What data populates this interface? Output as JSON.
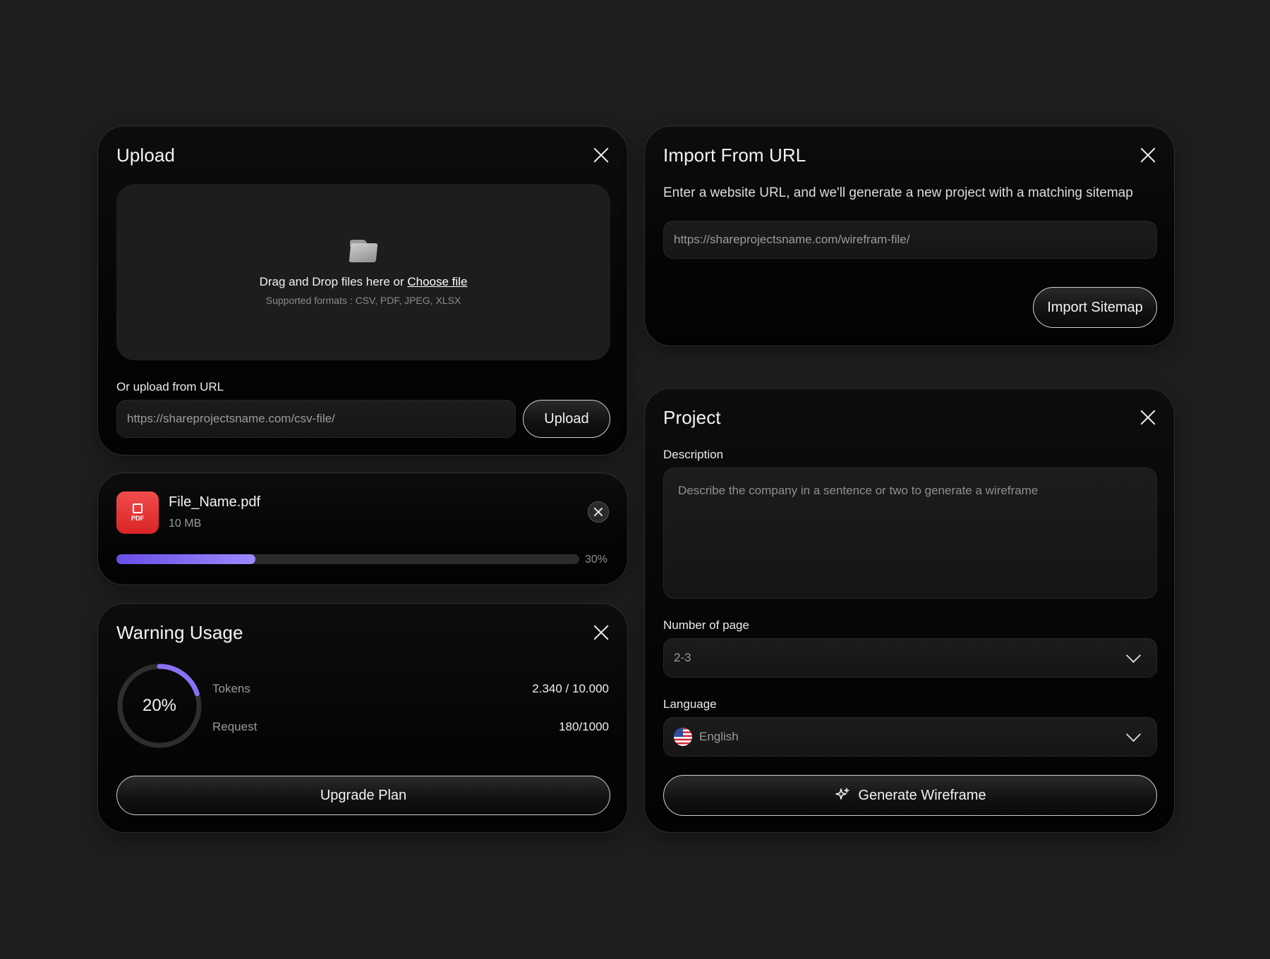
{
  "upload": {
    "title": "Upload",
    "drop_text": "Drag and Drop files here or",
    "choose_file": "Choose file",
    "formats": "Supported formats : CSV, PDF, JPEG, XLSX",
    "url_label": "Or upload from URL",
    "url_placeholder": "https://shareprojectsname.com/csv-file/",
    "upload_button": "Upload"
  },
  "file": {
    "badge": "PDF",
    "name": "File_Name.pdf",
    "size": "10 MB",
    "progress": 0.3,
    "progress_label": "30%"
  },
  "warning": {
    "title": "Warning Usage",
    "percent": 0.2,
    "percent_label": "20%",
    "tokens_label": "Tokens",
    "tokens_value": "2.340 / 10.000",
    "request_label": "Request",
    "request_value": "180/1000",
    "upgrade_button": "Upgrade Plan"
  },
  "import": {
    "title": "Import From URL",
    "description": "Enter a website URL, and we'll generate a new project with a matching sitemap",
    "url_placeholder": "https://shareprojectsname.com/wirefram-file/",
    "import_button": "Import Sitemap"
  },
  "project": {
    "title": "Project",
    "description_label": "Description",
    "description_placeholder": "Describe the company in a sentence or two to generate a wireframe",
    "pages_label": "Number of page",
    "pages_value": "2-3",
    "language_label": "Language",
    "language_value": "English",
    "generate_button": "Generate Wireframe"
  },
  "colors": {
    "accent": "#7b63f0",
    "pdf_red": "#e53535",
    "background": "#1e1e1e"
  }
}
